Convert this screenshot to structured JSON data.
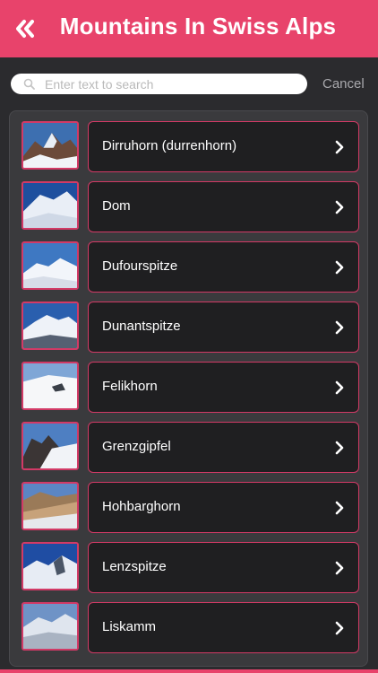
{
  "header": {
    "title": "Mountains In Swiss Alps"
  },
  "search": {
    "placeholder": "Enter text to search",
    "value": "",
    "cancel_label": "Cancel"
  },
  "colors": {
    "accent": "#e8436b",
    "card_border": "#d23a66",
    "background": "#2b2b2e"
  },
  "icons": {
    "back": "double-chevron-left-icon",
    "search": "search-icon",
    "row_arrow": "chevron-right-icon"
  },
  "items": [
    {
      "label": "Dirruhorn (durrenhorn)"
    },
    {
      "label": "Dom"
    },
    {
      "label": "Dufourspitze"
    },
    {
      "label": "Dunantspitze"
    },
    {
      "label": "Felikhorn"
    },
    {
      "label": "Grenzgipfel"
    },
    {
      "label": "Hohbarghorn"
    },
    {
      "label": "Lenzspitze"
    },
    {
      "label": "Liskamm"
    }
  ]
}
